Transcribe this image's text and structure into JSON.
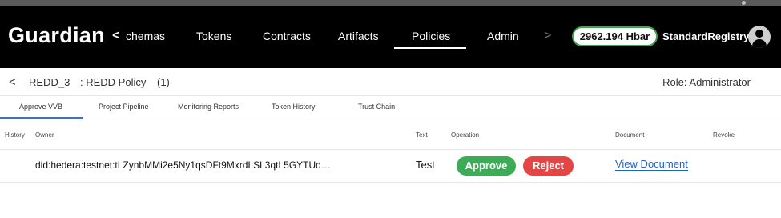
{
  "app": {
    "brand": "Guardian"
  },
  "nav": {
    "prev_label": "<",
    "next_label": ">",
    "items": [
      "chemas",
      "Tokens",
      "Contracts",
      "Artifacts",
      "Policies",
      "Admin"
    ],
    "active": "Policies"
  },
  "account": {
    "balance": "2962.194 Hbar",
    "user": "StandardRegistry",
    "balance_border_color": "#3ea64a"
  },
  "policy": {
    "back": "<",
    "name": "REDD_3",
    "title": ": REDD Policy",
    "version": "(1)",
    "role": "Role: Administrator"
  },
  "tabs": {
    "items": [
      "Approve VVB",
      "Project Pipeline",
      "Monitoring Reports",
      "Token History",
      "Trust Chain"
    ],
    "active": "Approve VVB",
    "accent_color": "#4a6fb3"
  },
  "table": {
    "headers": [
      "History",
      "Owner",
      "Text",
      "Operation",
      "Document",
      "Revoke"
    ],
    "rows": [
      {
        "owner": "did:hedera:testnet:tLZynbMMi2e5Ny1qsDFt9MxrdLSL3qtL5GYTUd…",
        "text": "Test",
        "approve": "Approve",
        "reject": "Reject",
        "document": "View Document"
      }
    ]
  },
  "colors": {
    "approve": "#3dac56",
    "reject": "#e64545",
    "link": "#1f63c7"
  },
  "icons": [
    "chevron-left-icon",
    "chevron-right-icon",
    "account-circle-icon"
  ]
}
